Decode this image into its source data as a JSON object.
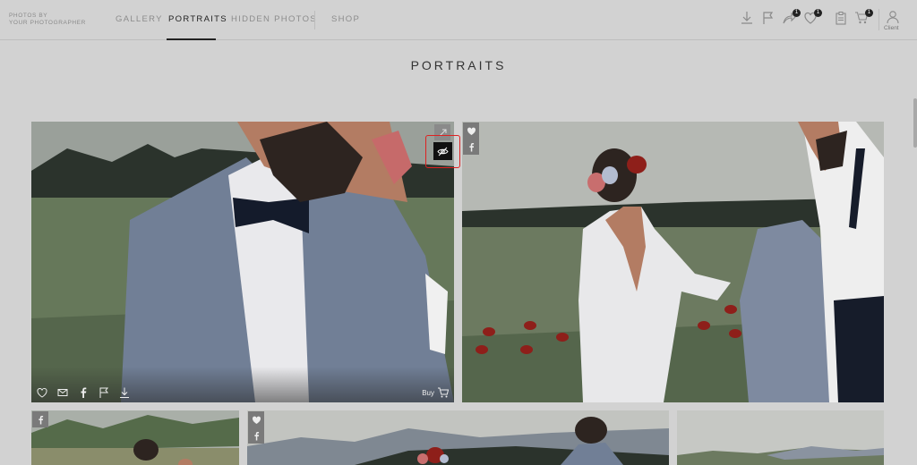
{
  "header": {
    "brand_line1": "PHOTOS BY",
    "brand_line2": "YOUR PHOTOGRAPHER",
    "nav": [
      {
        "label": "GALLERY"
      },
      {
        "label": "PORTRAITS"
      },
      {
        "label": "HIDDEN PHOTOS"
      },
      {
        "label": "SHOP"
      }
    ],
    "active_nav": "PORTRAITS",
    "icons": {
      "download": "download-icon",
      "flag": "flag-icon",
      "share": "share-icon",
      "favorites": "heart-icon",
      "orders": "clipboard-icon",
      "cart": "cart-icon",
      "client": "user-icon"
    },
    "badges": {
      "share": "1",
      "favorites": "1",
      "cart": "1"
    },
    "client_label": "Client"
  },
  "page": {
    "title": "PORTRAITS"
  },
  "photo_tools": {
    "buy_label": "Buy"
  },
  "colors": {
    "background": "#d2d2d2",
    "accent": "#222222",
    "highlight": "#dd2222"
  }
}
